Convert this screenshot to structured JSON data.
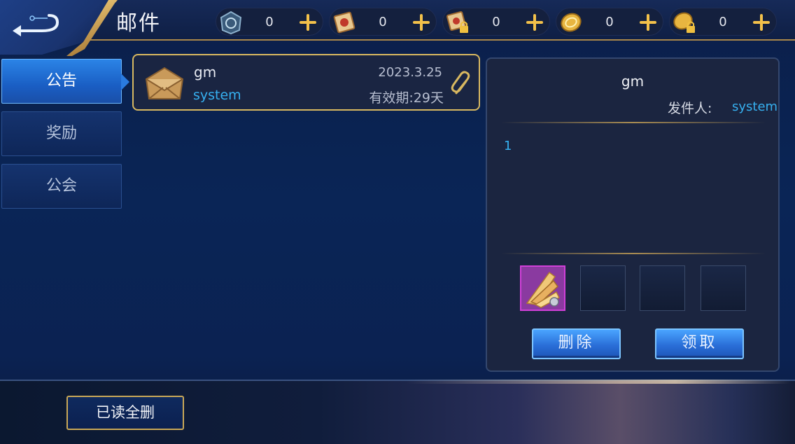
{
  "header": {
    "title": "邮件",
    "currencies": [
      {
        "icon": "coupon-icon",
        "value": "0"
      },
      {
        "icon": "scroll-icon",
        "value": "0"
      },
      {
        "icon": "locked-scroll-icon",
        "value": "0"
      },
      {
        "icon": "gold-coin-icon",
        "value": "0"
      },
      {
        "icon": "locked-gold-coin-icon",
        "value": "0"
      }
    ]
  },
  "sidebar": {
    "tabs": [
      {
        "label": "公告",
        "active": true
      },
      {
        "label": "奖励",
        "active": false
      },
      {
        "label": "公会",
        "active": false
      }
    ]
  },
  "mail_list": [
    {
      "title": "gm",
      "from": "system",
      "date": "2023.3.25",
      "expire": "有效期:29天",
      "has_attachment": true
    }
  ],
  "detail": {
    "title": "gm",
    "sender_label": "发件人:",
    "sender": "system",
    "body": "1",
    "attachments_filled": 1,
    "attachment_slots": 4,
    "delete_label": "删除",
    "claim_label": "领取"
  },
  "footer": {
    "delete_read_label": "已读全删"
  },
  "colors": {
    "accent_blue": "#36b0f0",
    "gold_border": "#d8b860",
    "button_blue": "#2a6fd8"
  }
}
